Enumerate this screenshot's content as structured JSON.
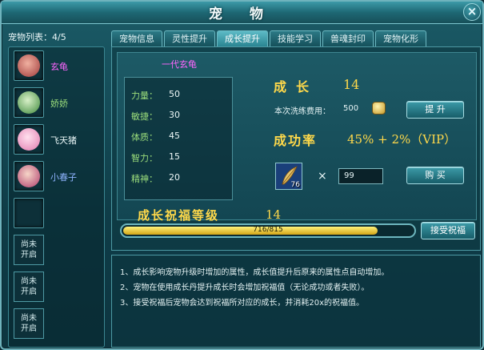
{
  "window": {
    "title": "宠 物",
    "close_glyph": "×"
  },
  "pet_list": {
    "header": "宠物列表：4/5",
    "pets": [
      {
        "name": "玄龟",
        "name_color": "#ff66ff",
        "avatar_color": "#c95a5a",
        "avatar_icon": "red-beast-avatar-icon"
      },
      {
        "name": "娇娇",
        "name_color": "#9bdd7b",
        "avatar_color": "#4e9a4a",
        "avatar_icon": "green-plant-avatar-icon"
      },
      {
        "name": "飞天猪",
        "name_color": "#e9f6f7",
        "avatar_color": "#f0a0c8",
        "avatar_icon": "pink-pig-avatar-icon"
      },
      {
        "name": "小春子",
        "name_color": "#8fb4ff",
        "avatar_color": "#c04a7a",
        "avatar_icon": "girl-avatar-icon"
      }
    ],
    "locked_label_line1": "尚未",
    "locked_label_line2": "开启"
  },
  "tabs": [
    "宠物信息",
    "灵性提升",
    "成长提升",
    "技能学习",
    "兽魂封印",
    "宠物化形"
  ],
  "active_tab": 2,
  "growth": {
    "generation": "一代玄龟",
    "stats": [
      {
        "label": "力量：",
        "value": "50"
      },
      {
        "label": "敏捷：",
        "value": "30"
      },
      {
        "label": "体质：",
        "value": "45"
      },
      {
        "label": "智力：",
        "value": "15"
      },
      {
        "label": "精神：",
        "value": "20"
      }
    ],
    "growth_label": "成长",
    "growth_value": "14",
    "cost_label": "本次洗练费用：",
    "cost_value": "500",
    "upgrade_button": "提 升",
    "success_label": "成功率",
    "success_value": "45% + 2%（VIP）",
    "item_count": "76",
    "times": "×",
    "quantity": "99",
    "buy_button": "购 买",
    "bless_label": "成长祝福等级",
    "bless_value": "14",
    "bless_progress_text": "716/815",
    "bless_progress": 0.878,
    "accept_button": "接受祝福"
  },
  "notes": [
    "1、成长影响宠物升级时增加的属性，成长值提升后原来的属性点自动增加。",
    "2、宠物在使用成长丹提升成长时会增加祝福值（无论成功或者失败）。",
    "3、接受祝福后宠物会达到祝福所对应的成长，并消耗20x的祝福值。"
  ]
}
